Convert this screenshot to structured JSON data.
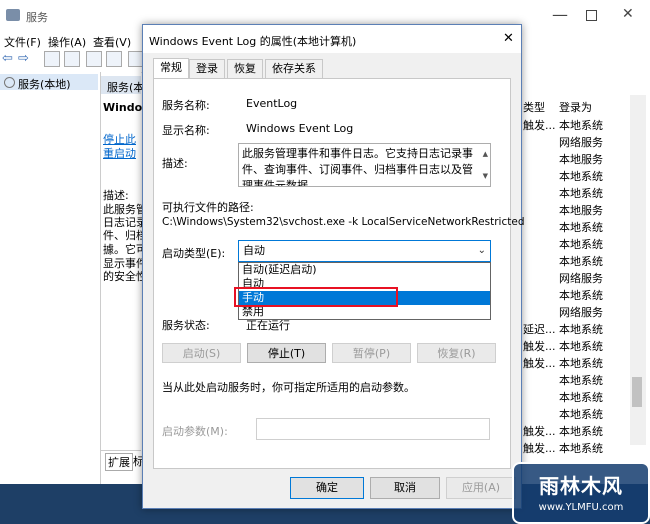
{
  "background_window": {
    "title": "服务",
    "menu": [
      "文件(F)",
      "操作(A)",
      "查看(V)"
    ],
    "tree_item": "服务(本地)",
    "detail_header": "服务(本地)",
    "detail_title": "Windov",
    "detail_link1": "停止此",
    "detail_link2": "重启动",
    "detail_desc_lines": [
      "描述:",
      "此服务管",
      "日志记录",
      "件、归档",
      "據。它可",
      "显示事件",
      "的安全性"
    ],
    "bottom_tabs": [
      "扩展",
      "标"
    ],
    "list_headers": [
      "类型",
      "登录为"
    ],
    "list_rows": [
      [
        "触发...",
        "本地系统"
      ],
      [
        "",
        "网络服务"
      ],
      [
        "",
        "本地服务"
      ],
      [
        "",
        "本地系统"
      ],
      [
        "",
        "本地系统"
      ],
      [
        "",
        "本地服务"
      ],
      [
        "",
        "本地系统"
      ],
      [
        "",
        "本地系统"
      ],
      [
        "",
        "本地系统"
      ],
      [
        "",
        "网络服务"
      ],
      [
        "",
        "本地系统"
      ],
      [
        "",
        "网络服务"
      ],
      [
        "延迟...",
        "本地系统"
      ],
      [
        "触发...",
        "本地系统"
      ],
      [
        "触发...",
        "本地系统"
      ],
      [
        "",
        "本地系统"
      ],
      [
        "",
        "本地系统"
      ],
      [
        "",
        "本地系统"
      ],
      [
        "触发...",
        "本地系统"
      ],
      [
        "触发...",
        "本地系统"
      ]
    ]
  },
  "dialog": {
    "title": "Windows Event Log 的属性(本地计算机)",
    "close_glyph": "✕",
    "tabs": [
      "常规",
      "登录",
      "恢复",
      "依存关系"
    ],
    "service_name_label": "服务名称:",
    "service_name_value": "EventLog",
    "display_name_label": "显示名称:",
    "display_name_value": "Windows Event Log",
    "description_label": "描述:",
    "description_value": "此服务管理事件和事件日志。它支持日志记录事件、查询事件、订阅事件、归档事件日志以及管理事件元数据",
    "exe_path_label": "可执行文件的路径:",
    "exe_path_value": "C:\\Windows\\System32\\svchost.exe -k LocalServiceNetworkRestricted",
    "startup_type_label": "启动类型(E):",
    "startup_type_value": "自动",
    "startup_options": [
      "自动(延迟启动)",
      "自动",
      "手动",
      "禁用"
    ],
    "selected_option_index": 2,
    "service_status_label": "服务状态:",
    "service_status_value": "正在运行",
    "start_button": "启动(S)",
    "stop_button": "停止(T)",
    "pause_button": "暂停(P)",
    "resume_button": "恢复(R)",
    "start_hint": "当从此处启动服务时，你可指定所适用的启动参数。",
    "start_params_label": "启动参数(M):",
    "ok_button": "确定",
    "cancel_button": "取消",
    "apply_button": "应用(A)"
  },
  "watermark": {
    "brand": "雨林木风",
    "url": "www.YLMFU.com"
  },
  "colors": {
    "accent": "#0078d7",
    "highlight_box": "#e81123"
  }
}
